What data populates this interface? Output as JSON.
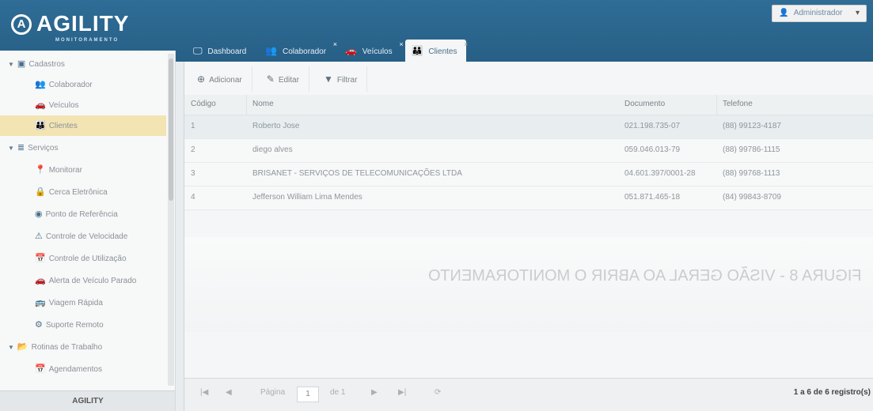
{
  "header": {
    "logo_text": "AGILITY",
    "logo_sub": "MONITORAMENTO",
    "logo_mark": "A",
    "user_label": "Administrador",
    "user_caret": "▾"
  },
  "tabs": [
    {
      "label": "Dashboard",
      "icon": "monitor-icon",
      "glyph": "🖵",
      "close": ""
    },
    {
      "label": "Colaborador",
      "icon": "users-icon",
      "glyph": "👥",
      "close": "×"
    },
    {
      "label": "Veículos",
      "icon": "car-icon",
      "glyph": "🚗",
      "close": "×"
    },
    {
      "label": "Clientes",
      "icon": "group-icon",
      "glyph": "👪",
      "close": "×"
    }
  ],
  "sidebar": {
    "items": [
      {
        "label": "Cadastros",
        "type": "group",
        "glyph": "▣",
        "arrow": "▼"
      },
      {
        "label": "Colaborador",
        "type": "child",
        "glyph": "👥"
      },
      {
        "label": "Veículos",
        "type": "child",
        "glyph": "🚗"
      },
      {
        "label": "Clientes",
        "type": "child",
        "glyph": "👪",
        "active": true
      },
      {
        "label": "Serviços",
        "type": "group",
        "glyph": "≣",
        "arrow": "▼"
      },
      {
        "label": "Monitorar",
        "type": "child",
        "glyph": "📍"
      },
      {
        "label": "Cerca Eletrônica",
        "type": "child",
        "glyph": "🔒"
      },
      {
        "label": "Ponto de Referência",
        "type": "child",
        "glyph": "◉"
      },
      {
        "label": "Controle de Velocidade",
        "type": "child",
        "glyph": "⚠"
      },
      {
        "label": "Controle de Utilização",
        "type": "child",
        "glyph": "📅"
      },
      {
        "label": "Alerta de Veículo Parado",
        "type": "child",
        "glyph": "🚗"
      },
      {
        "label": "Viagem Rápida",
        "type": "child",
        "glyph": "🚌"
      },
      {
        "label": "Suporte Remoto",
        "type": "child",
        "glyph": "⚙"
      },
      {
        "label": "Rotinas de Trabalho",
        "type": "group",
        "glyph": "📂",
        "arrow": "▼"
      },
      {
        "label": "Agendamentos",
        "type": "child",
        "glyph": "📅"
      }
    ],
    "footer": "AGILITY"
  },
  "toolbar": {
    "add_label": "Adicionar",
    "edit_label": "Editar",
    "filter_label": "Filtrar"
  },
  "table": {
    "headers": {
      "codigo": "Código",
      "nome": "Nome",
      "documento": "Documento",
      "telefone": "Telefone"
    },
    "rows": [
      {
        "codigo": "1",
        "nome": "Roberto Jose",
        "documento": "021.198.735-07",
        "telefone": "(88) 99123-4187"
      },
      {
        "codigo": "2",
        "nome": "diego alves",
        "documento": "059.046.013-79",
        "telefone": "(88) 99786-1115"
      },
      {
        "codigo": "3",
        "nome": "BRISANET - SERVIÇOS DE TELECOMUNICAÇÕES LTDA",
        "documento": "04.601.397/0001-28",
        "telefone": "(88) 99768-1113"
      },
      {
        "codigo": "4",
        "nome": "Jefferson William Lima Mendes",
        "documento": "051.871.465-18",
        "telefone": "(84) 99843-8709"
      }
    ]
  },
  "pager": {
    "page_label": "Página",
    "page_value": "1",
    "of_label": "de 1",
    "info": "1 a 6 de 6 registro(s)"
  },
  "ghost_caption": "FIGURA 8 - VISÃO GERAL AO ABRIR O MONITORAMENTO"
}
